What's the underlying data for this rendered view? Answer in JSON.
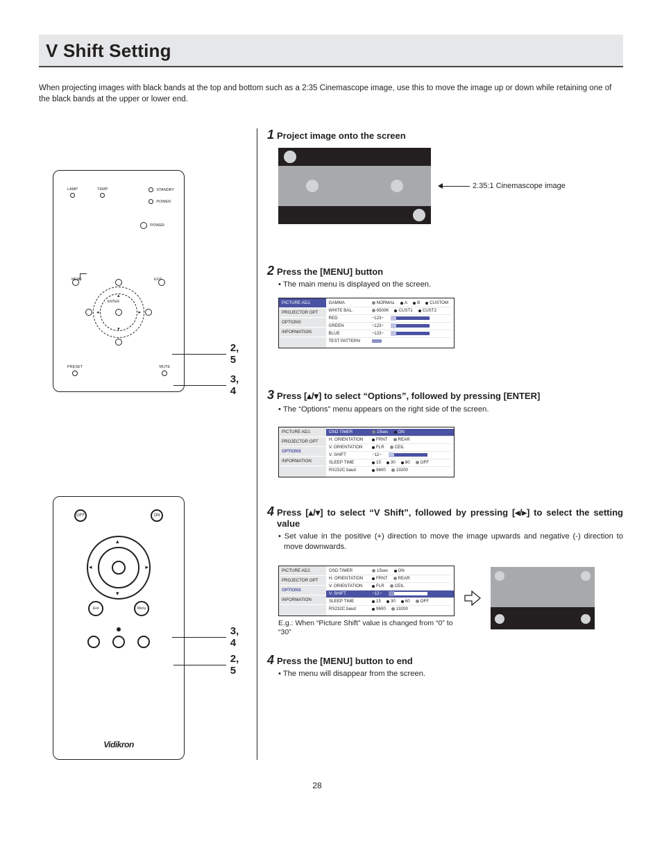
{
  "page_number": "28",
  "title": "V Shift Setting",
  "intro": "When projecting images with black bands at the top and bottom such as a 2:35 Cinemascope image, use this to move the image up or down while retaining one of the black bands at the upper or lower end.",
  "callouts": {
    "c25": "2, 5",
    "c34": "3, 4"
  },
  "panel": {
    "lamp": "LAMP",
    "temp": "TEMP",
    "standby": "STANDBY",
    "power": "POWER",
    "power_btn": "POWER",
    "menu": "MENU",
    "exit": "EXIT",
    "enter": "ENTER",
    "preset": "PRESET",
    "mute": "MUTE"
  },
  "remote": {
    "off": "OFF",
    "on": "ON",
    "exit": "Exit",
    "menu": "Menu",
    "logo": "Vidikron"
  },
  "step1": {
    "num": "1",
    "title": "Project image onto the screen",
    "leader": "2.35:1 Cinemascope image"
  },
  "step2": {
    "num": "2",
    "title": "Press the [MENU] button",
    "bullet": "The main menu is displayed on the screen."
  },
  "step3": {
    "num": "3",
    "title": "Press [▴/▾] to select “Options”, followed by pressing [ENTER]",
    "bullet": "The “Options” menu appears on the right side of the screen."
  },
  "step4": {
    "num": "4",
    "title": "Press [▴/▾] to select “V Shift”, followed by pressing [◂/▸] to select the setting value",
    "bullet": "Set value in the positive (+) direction to move the image upwards and negative (-) direction to move downwards.",
    "caption": "E.g.: When “Picture Shift” value is changed from “0” to “30”"
  },
  "step5": {
    "num": "4",
    "title": "Press the [MENU] button to end",
    "bullet": "The menu will disappear from the screen."
  },
  "osd_side": {
    "picture": "PICTURE ADJ.",
    "projector": "PROJECTOR OPT",
    "options": "OPTIONS",
    "information": "INFORMATION"
  },
  "osd2": {
    "gamma": "GAMMA",
    "normal": "NORMAL",
    "a": "A",
    "b": "B",
    "custom": "CUSTOM",
    "wb": "WHITE BAL.",
    "k6500": "6500K",
    "cust1": "CUST1",
    "cust2": "CUST2",
    "red": "RED",
    "green": "GREEN",
    "blue": "BLUE",
    "v123": "−123−",
    "tp": "TEST PATTERN"
  },
  "osd3": {
    "osd_timer": "OSD TIMER",
    "t15": "15sec",
    "on": "ON",
    "horient": "H. ORIENTATION",
    "frnt": "FRNT",
    "rear": "REAR",
    "vorient": "V. ORIENTATION",
    "flr": "FLR",
    "ceil": "CEIL",
    "vshift": "V. SHIFT",
    "v12": "−12−",
    "sleep": "SLEEP TIME",
    "s15": "15",
    "s30": "30",
    "s60": "60",
    "off": "OFF",
    "baud": "RS232C baud",
    "b9600": "9600",
    "b19200": "19200"
  }
}
